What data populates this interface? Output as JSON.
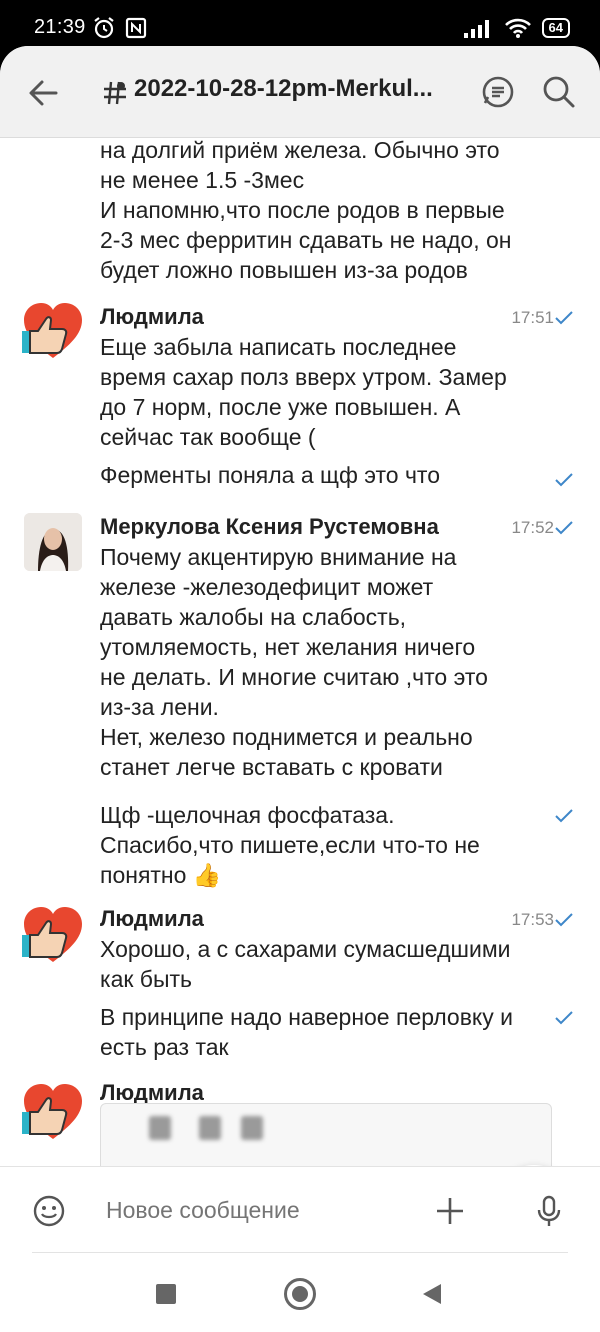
{
  "status_bar": {
    "time": "21:39",
    "battery": "64"
  },
  "header": {
    "title": "2022-10-28-12pm-Merkul..."
  },
  "messages": [
    {
      "lines": [
        "на долгий приём железа. Обычно это",
        "не менее 1.5 -3мес",
        "И напомню,что после родов в первые",
        "2-3 мес ферритин сдавать не надо, он",
        "будет ложно повышен из-за родов"
      ]
    },
    {
      "sender": "Людмила",
      "time": "17:51",
      "lines": [
        "Еще забыла написать последнее",
        "время сахар полз вверх утром. Замер",
        "до 7 норм, после уже повышен. А",
        "сейчас так вообще ("
      ]
    },
    {
      "lines": [
        "Ферменты поняла а щф это что"
      ]
    },
    {
      "sender": "Меркулова Ксения Рустемовна",
      "time": "17:52",
      "lines": [
        "Почему акцентирую внимание на",
        "железе -железодефицит может",
        "давать жалобы на слабость,",
        "утомляемость, нет желания ничего",
        "не делать. И многие считаю ,что это",
        "из-за лени.",
        "Нет, железо поднимется и реально",
        "станет легче вставать с кровати"
      ]
    },
    {
      "lines": [
        "Щф -щелочная фосфатаза.",
        "Спасибо,что пишете,если что-то не",
        "понятно 👍"
      ]
    },
    {
      "sender": "Людмила",
      "time": "17:53",
      "lines": [
        "Хорошо, а с сахарами сумасшедшими",
        "как быть"
      ]
    },
    {
      "lines": [
        "В принципе надо наверное перловку и",
        "есть раз так"
      ]
    },
    {
      "sender": "Людмила"
    }
  ],
  "composer": {
    "placeholder": "Новое сообщение"
  },
  "colors": {
    "accent": "#3e87c9",
    "heart_red": "#e8472f",
    "thumb": "#f5d3b4"
  }
}
